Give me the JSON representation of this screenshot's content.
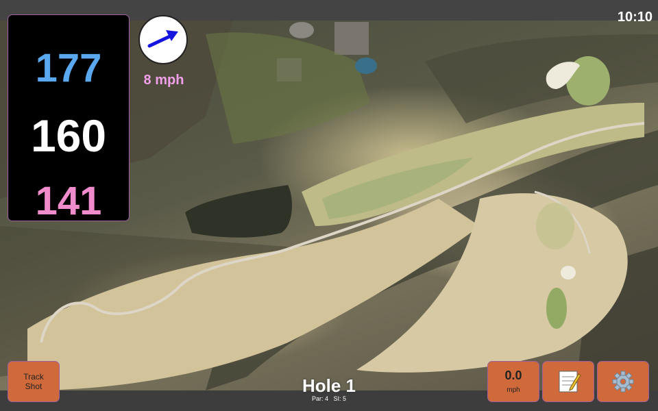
{
  "status": {
    "time": "10:10"
  },
  "distances": {
    "back": "177",
    "middle": "160",
    "front": "141"
  },
  "wind": {
    "speed_text": "8 mph",
    "arrow_icon": "wind-arrow-icon"
  },
  "hole": {
    "title": "Hole 1",
    "par": "Par: 4",
    "si": "SI: 5"
  },
  "buttons": {
    "track_shot": "Track Shot",
    "speed_value": "0.0",
    "speed_unit": "mph",
    "notes_icon": "notepad-icon",
    "settings_icon": "gear-icon"
  },
  "colors": {
    "back": "#5aa9f0",
    "middle": "#ffffff",
    "front": "#f08ccc",
    "button": "#d06a3a",
    "wind_text": "#f0a0e8"
  }
}
